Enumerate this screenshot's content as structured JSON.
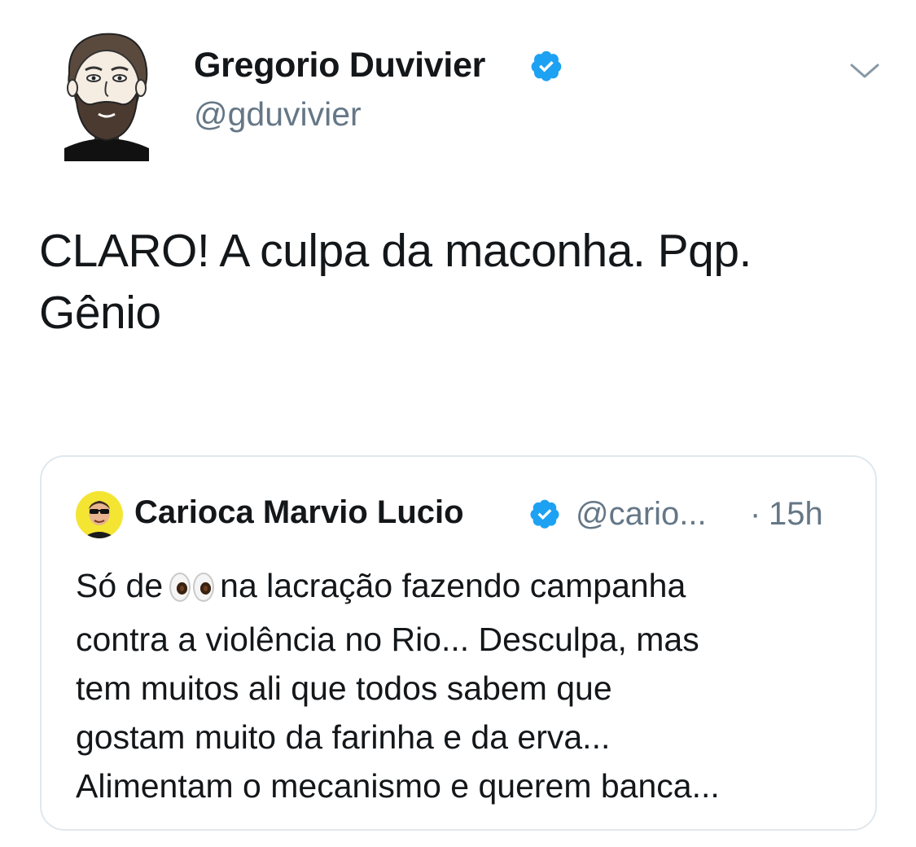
{
  "tweet": {
    "author": {
      "display_name": "Gregorio Duvivier",
      "handle": "@gduvivier",
      "verified": true
    },
    "text_lines": [
      "CLARO! A culpa da maconha. Pqp.",
      "Gênio"
    ]
  },
  "quoted_tweet": {
    "author": {
      "display_name": "Carioca Marvio Lucio",
      "handle": "@cario...",
      "verified": true
    },
    "separator": "·",
    "time": "15h",
    "line1_before_emoji": "Só de",
    "line1_after_emoji": "na lacração fazendo campanha",
    "lines": [
      "contra a violência no Rio... Desculpa, mas",
      "tem muitos ali que todos sabem que",
      "gostam muito da farinha e da erva...",
      "Alimentam o mecanismo e querem banca..."
    ]
  },
  "icons": {
    "verified": "verified-badge-icon",
    "more": "chevron-down-icon",
    "emoji": "eyes-emoji-icon"
  },
  "colors": {
    "verified": "#1da1f2",
    "secondary_text": "#657786",
    "border": "#e1e8ed"
  }
}
